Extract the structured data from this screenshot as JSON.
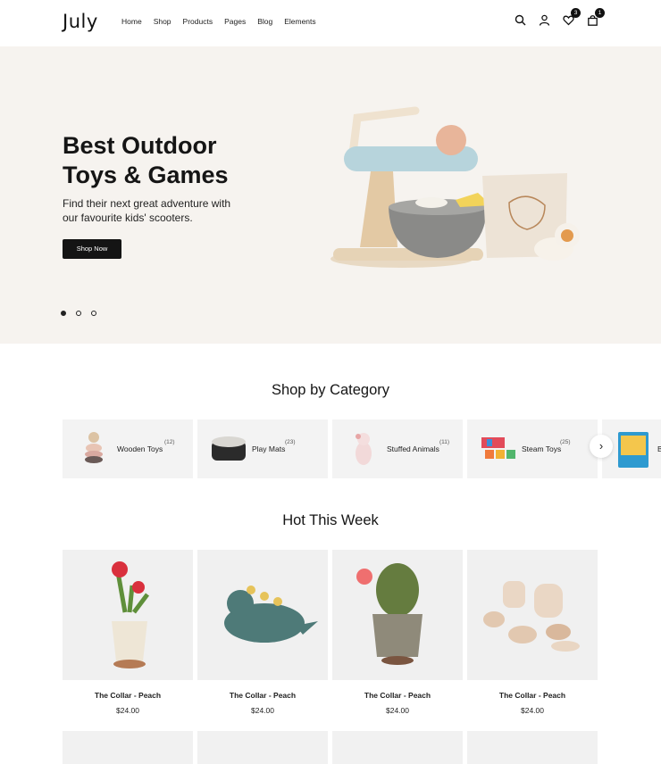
{
  "header": {
    "logo": "July",
    "nav": [
      "Home",
      "Shop",
      "Products",
      "Pages",
      "Blog",
      "Elements"
    ],
    "wishlist_count": "3",
    "cart_count": "1"
  },
  "hero": {
    "title": "Best Outdoor Toys & Games",
    "subtitle": "Find their next great adventure with our favourite kids' scooters.",
    "button": "Shop Now",
    "slides": 3,
    "active_slide": 1
  },
  "categories": {
    "title": "Shop by Category",
    "items": [
      {
        "name": "Wooden Toys",
        "count": "(12)"
      },
      {
        "name": "Play Mats",
        "count": "(23)"
      },
      {
        "name": "Stuffed Animals",
        "count": "(11)"
      },
      {
        "name": "Steam Toys",
        "count": "(25)"
      },
      {
        "name": "B",
        "count": ""
      }
    ]
  },
  "hot": {
    "title": "Hot This Week",
    "products": [
      {
        "name": "The Collar - Peach",
        "price": "$24.00"
      },
      {
        "name": "The Collar - Peach",
        "price": "$24.00"
      },
      {
        "name": "The Collar - Peach",
        "price": "$24.00"
      },
      {
        "name": "The Collar - Peach",
        "price": "$24.00"
      }
    ]
  },
  "colors": {
    "hero_bg": "#f6f3ef",
    "button_bg": "#141414",
    "card_bg": "#f3f3f3"
  },
  "icons": [
    "search-icon",
    "user-icon",
    "heart-icon",
    "bag-icon",
    "chevron-right-icon"
  ]
}
